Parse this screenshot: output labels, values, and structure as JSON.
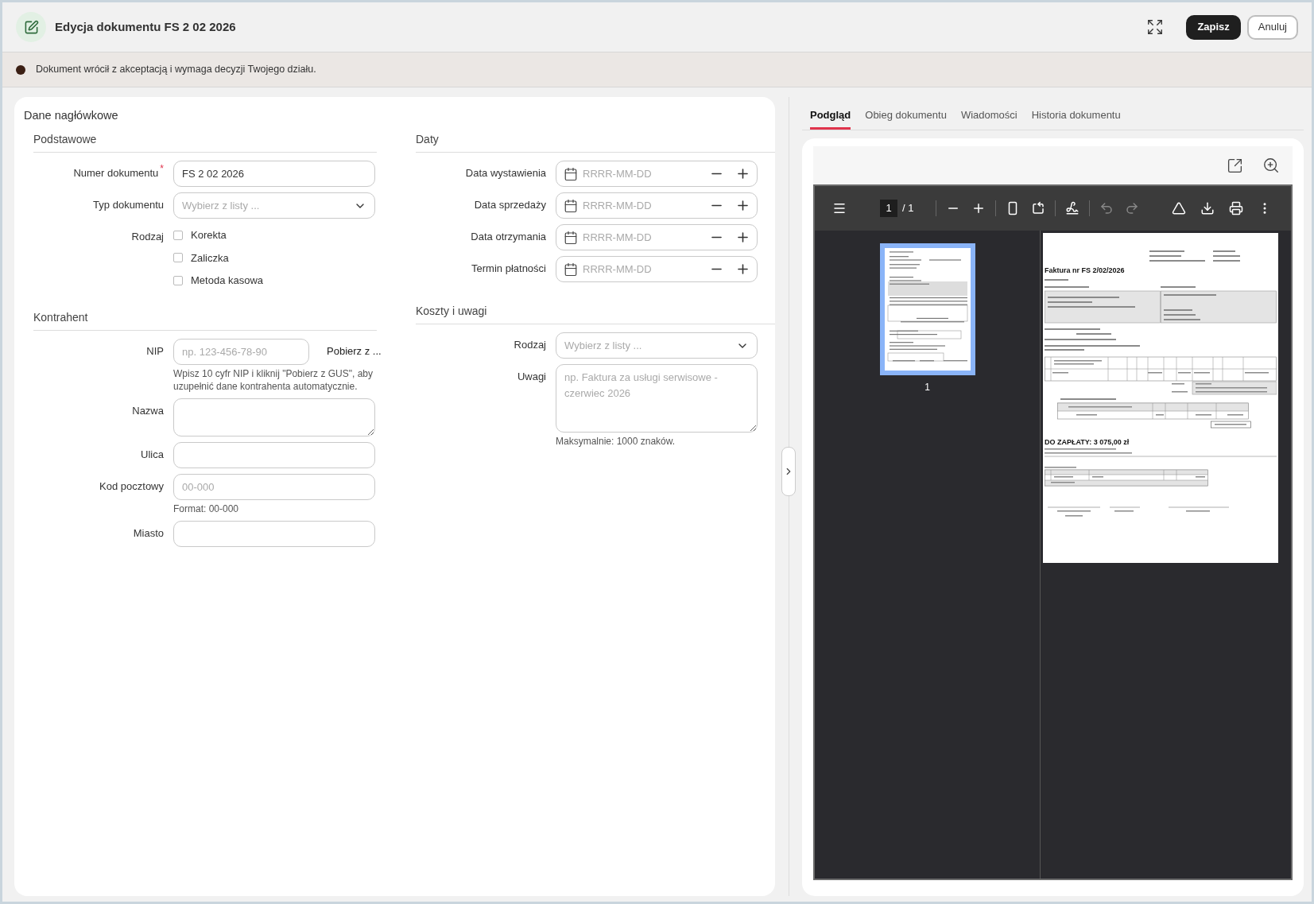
{
  "header": {
    "title": "Edycja dokumentu FS 2 02 2026",
    "buttons": [
      {
        "label": "Zapisz",
        "kind": "primary"
      },
      {
        "label": "Anuluj",
        "kind": "secondary"
      }
    ]
  },
  "alert": {
    "text": "Dokument wrócił z akceptacją i wymaga decyzji Twojego działu.",
    "color": "#3b1f14"
  },
  "form": {
    "title": "Dane nagłówkowe",
    "required_mark": "*",
    "columns": [
      [
        {
          "heading": "Podstawowe",
          "rows": [
            {
              "kind": "text",
              "label": "Numer dokumentu",
              "required": true,
              "value": "FS 2 02 2026"
            },
            {
              "kind": "select",
              "label": "Typ dokumentu",
              "required": false,
              "placeholder": "Wybierz z listy ..."
            },
            {
              "kind": "checkboxes",
              "label": "Rodzaj",
              "required": false,
              "options": [
                {
                  "label": "Korekta",
                  "checked": false
                },
                {
                  "label": "Zaliczka",
                  "checked": false
                },
                {
                  "label": "Metoda kasowa",
                  "checked": false
                }
              ]
            }
          ]
        },
        {
          "heading": "Kontrahent",
          "rows": [
            {
              "kind": "nip",
              "label": "NIP",
              "required": false,
              "placeholder": "np. 123-456-78-90",
              "action": "Pobierz z ...",
              "hint": "Wpisz 10 cyfr NIP i kliknij \"Pobierz z GUS\", aby uzupełnić dane kontrahenta automatycznie."
            },
            {
              "kind": "textarea",
              "label": "Nazwa",
              "required": false
            },
            {
              "kind": "text",
              "label": "Ulica",
              "required": false
            },
            {
              "kind": "text",
              "label": "Kod pocztowy",
              "required": false,
              "placeholder": "00-000",
              "hint": "Format: 00-000"
            },
            {
              "kind": "text",
              "label": "Miasto",
              "required": false
            }
          ]
        }
      ],
      [
        {
          "heading": "Daty",
          "rows": [
            {
              "kind": "date",
              "label": "Data wystawienia",
              "required": false,
              "placeholder": "RRRR-MM-DD"
            },
            {
              "kind": "date",
              "label": "Data sprzedaży",
              "required": false,
              "placeholder": "RRRR-MM-DD"
            },
            {
              "kind": "date",
              "label": "Data otrzymania",
              "required": false,
              "placeholder": "RRRR-MM-DD"
            },
            {
              "kind": "date",
              "label": "Termin płatności",
              "required": false,
              "placeholder": "RRRR-MM-DD"
            }
          ]
        },
        {
          "heading": "Koszty i uwagi",
          "rows": [
            {
              "kind": "select",
              "label": "Rodzaj",
              "required": false,
              "placeholder": "Wybierz z listy ..."
            },
            {
              "kind": "notes",
              "label": "Uwagi",
              "required": false,
              "placeholder": "np. Faktura za usługi serwisowe - czerwiec 2026",
              "hint": "Maksymalnie: 1000 znaków."
            }
          ]
        }
      ]
    ]
  },
  "preview": {
    "tabs": [
      {
        "label": "Podgląd",
        "selected": true
      },
      {
        "label": "Obieg dokumentu",
        "selected": false
      },
      {
        "label": "Wiadomości",
        "selected": false
      },
      {
        "label": "Historia dokumentu",
        "selected": false
      }
    ],
    "viewer": {
      "page": "1",
      "pages": "/ 1",
      "thumbnail_label": "1"
    },
    "invoice": {
      "title": "Faktura nr FS 2/02/2026",
      "due": "DO ZAPŁATY: 3 075,00 zł"
    }
  }
}
